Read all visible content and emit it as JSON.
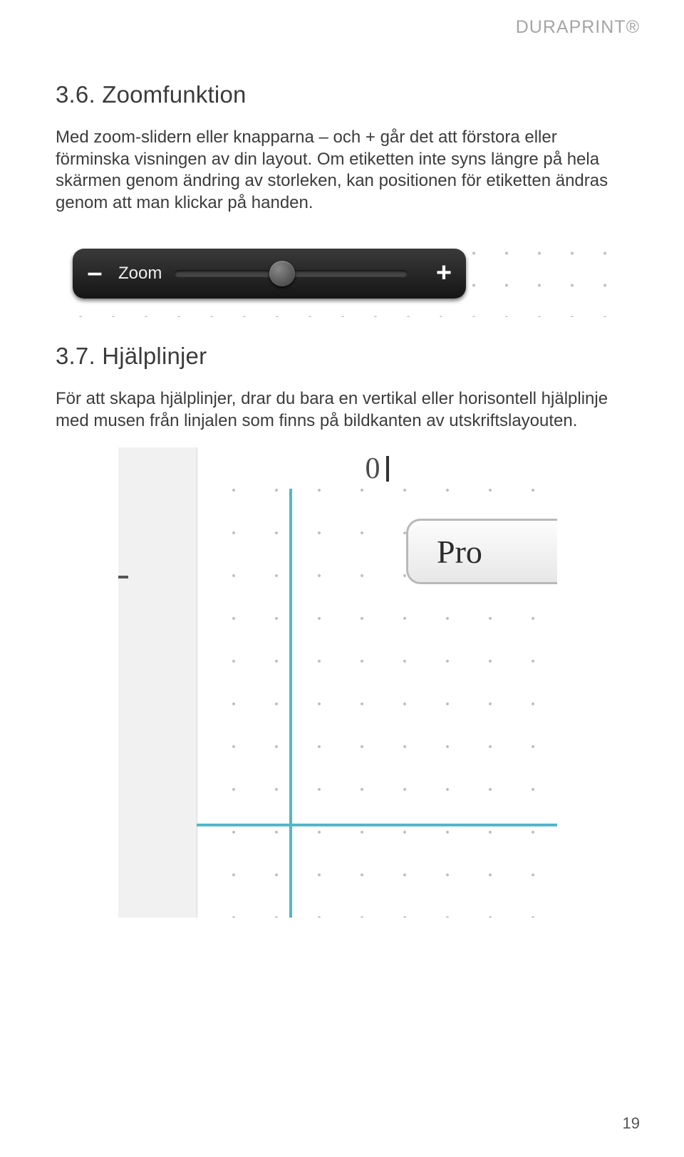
{
  "brand": "DURAPRINT®",
  "s1": {
    "heading": "3.6. Zoomfunktion",
    "body": "Med zoom-slidern eller knapparna – och + går det att förstora eller förminska visningen av din layout. Om etiketten inte syns längre på hela skärmen genom ändring av storleken, kan positionen för etiketten ändras genom att man klickar på handen."
  },
  "zoom": {
    "minus": "–",
    "label": "Zoom",
    "plus": "+"
  },
  "s2": {
    "heading": "3.7. Hjälplinjer",
    "body": "För att skapa hjälplinjer, drar du bara en vertikal eller horisontell hjälplinje med musen från linjalen som finns på bildkanten av utskriftslayouten."
  },
  "guide": {
    "ruler_zero": "0",
    "field_text": "Pro"
  },
  "page_number": "19"
}
